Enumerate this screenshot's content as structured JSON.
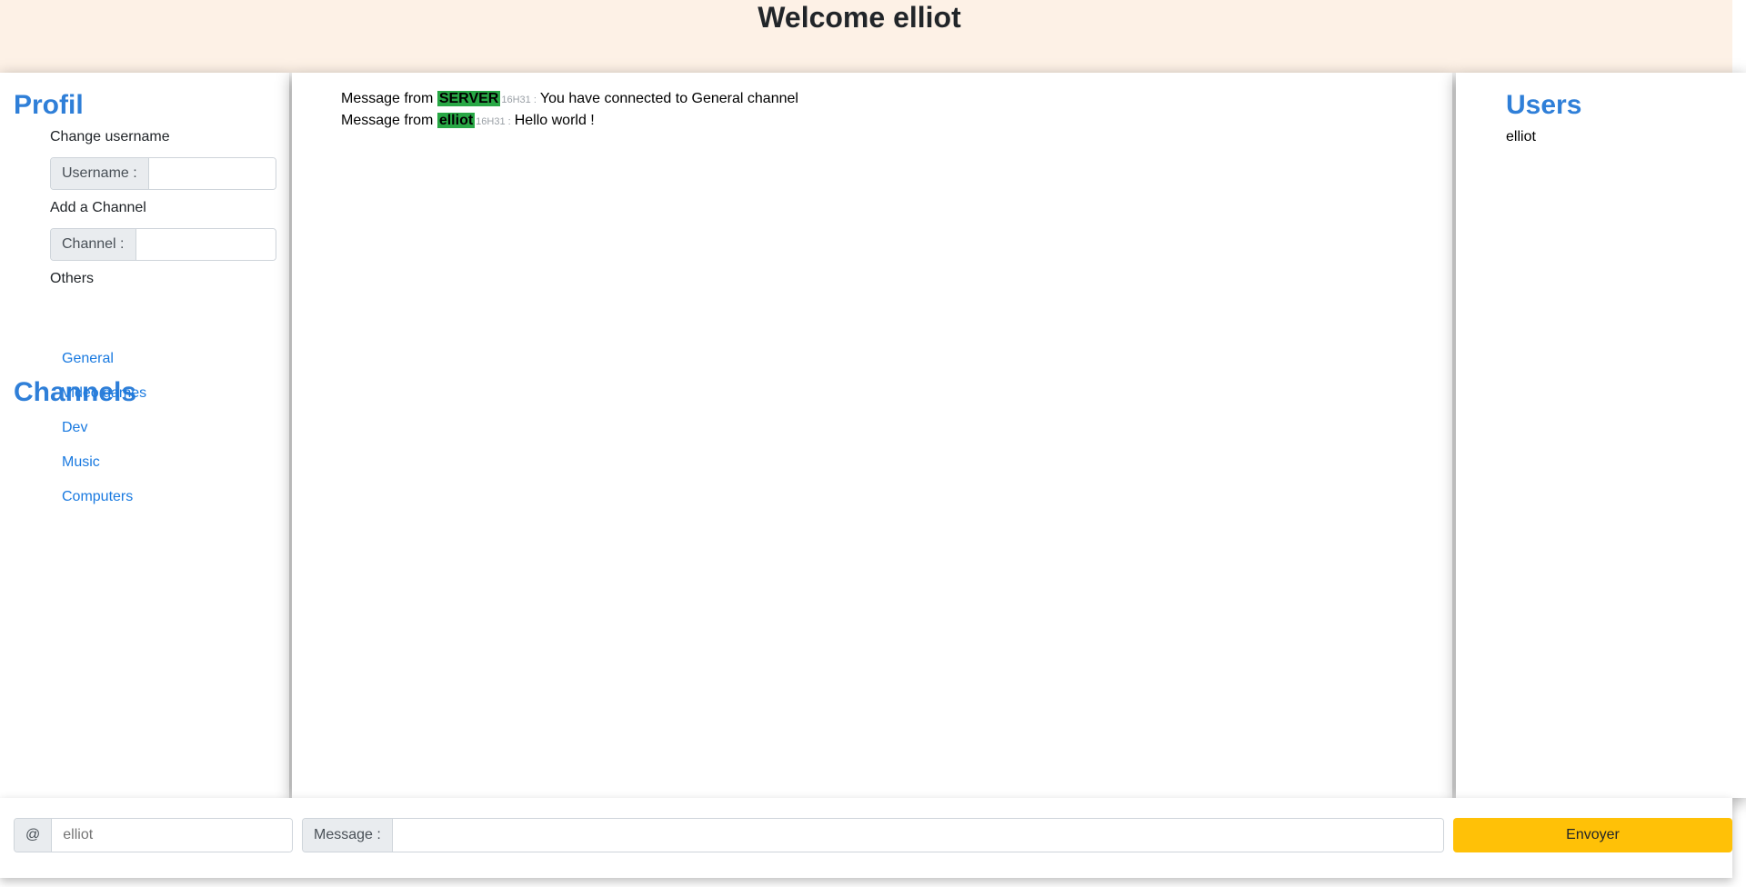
{
  "header": {
    "title": "Welcome elliot"
  },
  "profil": {
    "title": "Profil",
    "change_username_label": "Change username",
    "username_prefix": "Username :",
    "username_value": "",
    "add_channel_label": "Add a Channel",
    "channel_prefix": "Channel :",
    "channel_value": "",
    "others_label": "Others"
  },
  "channels": {
    "title": "Channels",
    "items": [
      {
        "label": "General"
      },
      {
        "label": "Video games"
      },
      {
        "label": "Dev"
      },
      {
        "label": "Music"
      },
      {
        "label": "Computers"
      }
    ]
  },
  "messages": [
    {
      "prefix": "Message from",
      "sender": "SERVER",
      "time": "16H31 :",
      "text": "You have connected to General channel"
    },
    {
      "prefix": "Message from",
      "sender": "elliot",
      "time": "16H31 :",
      "text": "Hello world !"
    }
  ],
  "users": {
    "title": "Users",
    "items": [
      {
        "name": "elliot"
      }
    ]
  },
  "composer": {
    "at_symbol": "@",
    "recipient_placeholder": "elliot",
    "message_prefix": "Message :",
    "message_value": "",
    "send_label": "Envoyer"
  },
  "colors": {
    "accent": "#2f7fd8",
    "link": "#1a7ae0",
    "sender_highlight": "#28a745",
    "send_button": "#ffc107",
    "banner": "#fdf1e6"
  }
}
